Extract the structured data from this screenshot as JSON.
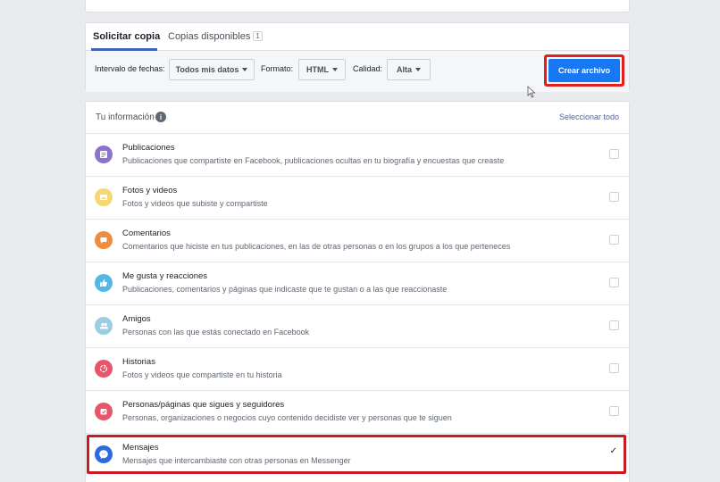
{
  "tabs": [
    {
      "label": "Solicitar copia"
    },
    {
      "label": "Copias disponibles",
      "count": "1"
    }
  ],
  "filters": {
    "date_label": "Intervalo de fechas:",
    "date_value": "Todos mis datos",
    "format_label": "Formato:",
    "format_value": "HTML",
    "quality_label": "Calidad:",
    "quality_value": "Alta",
    "create_label": "Crear archivo"
  },
  "info": {
    "title": "Tu información",
    "select_all": "Seleccionar todo",
    "items": [
      {
        "title": "Publicaciones",
        "desc": "Publicaciones que compartiste en Facebook, publicaciones ocultas en tu biografía y encuestas que creaste",
        "icon": "posts-icon",
        "color": "#8c72cb",
        "checked": false
      },
      {
        "title": "Fotos y videos",
        "desc": "Fotos y videos que subiste y compartiste",
        "icon": "photo-icon",
        "color": "#f7d774",
        "checked": false
      },
      {
        "title": "Comentarios",
        "desc": "Comentarios que hiciste en tus publicaciones, en las de otras personas o en los grupos a los que perteneces",
        "icon": "comment-icon",
        "color": "#f08c3c",
        "checked": false
      },
      {
        "title": "Me gusta y reacciones",
        "desc": "Publicaciones, comentarios y páginas que indicaste que te gustan o a las que reaccionaste",
        "icon": "like-icon",
        "color": "#54b8e6",
        "checked": false
      },
      {
        "title": "Amigos",
        "desc": "Personas con las que estás conectado en Facebook",
        "icon": "friends-icon",
        "color": "#9bcde4",
        "checked": false
      },
      {
        "title": "Historias",
        "desc": "Fotos y videos que compartiste en tu historia",
        "icon": "stories-icon",
        "color": "#e8556a",
        "checked": false
      },
      {
        "title": "Personas/páginas que sigues y seguidores",
        "desc": "Personas, organizaciones o negocios cuyo contenido decidiste ver y personas que te siguen",
        "icon": "following-icon",
        "color": "#e8556a",
        "checked": false
      },
      {
        "title": "Mensajes",
        "desc": "Mensajes que intercambiaste con otras personas en Messenger",
        "icon": "messenger-icon",
        "color": "#2d6ae0",
        "checked": true
      }
    ]
  }
}
